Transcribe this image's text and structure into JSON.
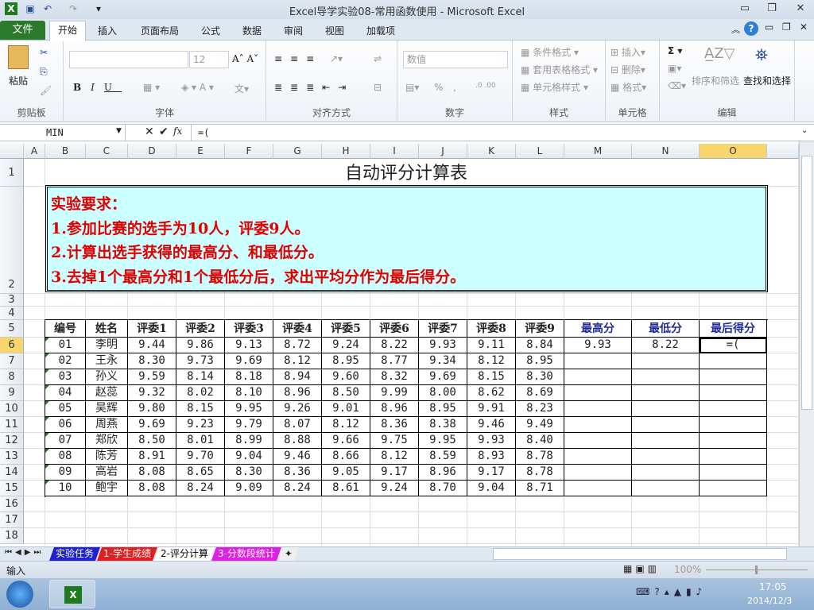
{
  "window": {
    "title": "Excel导学实验08-常用函数使用  -  Microsoft Excel"
  },
  "tabs": [
    "文件",
    "开始",
    "插入",
    "页面布局",
    "公式",
    "数据",
    "审阅",
    "视图",
    "加载项"
  ],
  "ribbon": {
    "clipboard": {
      "paste": "粘贴",
      "label": "剪贴板"
    },
    "font": {
      "name": "",
      "size": "12",
      "label": "字体"
    },
    "alignment": {
      "label": "对齐方式"
    },
    "number": {
      "format": "数值",
      "percent": "%",
      "comma": ",",
      "label": "数字"
    },
    "styles": {
      "conditional": "条件格式",
      "table": "套用表格格式",
      "cell": "单元格样式",
      "label": "样式"
    },
    "cells": {
      "insert": "插入",
      "delete": "删除",
      "format": "格式",
      "label": "单元格"
    },
    "editing": {
      "sort": "排序和筛选",
      "find": "查找和选择",
      "label": "编辑"
    }
  },
  "formula_bar": {
    "name_box": "MIN",
    "formula": "=(",
    "fx": "fx"
  },
  "columns": [
    "A",
    "B",
    "C",
    "D",
    "E",
    "F",
    "G",
    "H",
    "I",
    "J",
    "K",
    "L",
    "M",
    "N",
    "O"
  ],
  "rows": [
    "1",
    "2",
    "3",
    "4",
    "5",
    "6",
    "7",
    "8",
    "9",
    "10",
    "11",
    "12",
    "13",
    "14",
    "15",
    "16",
    "17",
    "18"
  ],
  "sheet": {
    "title": "自动评分计算表",
    "requirements": [
      "实验要求：",
      "1.参加比赛的选手为10人，评委9人。",
      "2.计算出选手获得的最高分、和最低分。",
      "3.去掉1个最高分和1个最低分后，求出平均分作为最后得分。"
    ],
    "headers": [
      "编号",
      "姓名",
      "评委1",
      "评委2",
      "评委3",
      "评委4",
      "评委5",
      "评委6",
      "评委7",
      "评委8",
      "评委9",
      "最高分",
      "最低分",
      "最后得分"
    ],
    "data": [
      [
        "01",
        "李明",
        "9.44",
        "9.86",
        "9.13",
        "8.72",
        "9.24",
        "8.22",
        "9.93",
        "9.11",
        "8.84",
        "9.93",
        "8.22",
        "=("
      ],
      [
        "02",
        "王永",
        "8.30",
        "9.73",
        "9.69",
        "8.12",
        "8.95",
        "8.77",
        "9.34",
        "8.12",
        "8.95",
        "",
        "",
        ""
      ],
      [
        "03",
        "孙义",
        "9.59",
        "8.14",
        "8.18",
        "8.94",
        "9.60",
        "8.32",
        "9.69",
        "8.15",
        "8.30",
        "",
        "",
        ""
      ],
      [
        "04",
        "赵蕊",
        "9.32",
        "8.02",
        "8.10",
        "8.96",
        "8.50",
        "9.99",
        "8.00",
        "8.62",
        "8.69",
        "",
        "",
        ""
      ],
      [
        "05",
        "吴辉",
        "9.80",
        "8.15",
        "9.95",
        "9.26",
        "9.01",
        "8.96",
        "8.95",
        "9.91",
        "8.23",
        "",
        "",
        ""
      ],
      [
        "06",
        "周燕",
        "9.69",
        "9.23",
        "9.79",
        "8.07",
        "8.12",
        "8.36",
        "8.38",
        "9.46",
        "9.49",
        "",
        "",
        ""
      ],
      [
        "07",
        "郑欣",
        "8.50",
        "8.01",
        "8.99",
        "8.88",
        "9.66",
        "9.75",
        "9.95",
        "9.93",
        "8.40",
        "",
        "",
        ""
      ],
      [
        "08",
        "陈芳",
        "8.91",
        "9.70",
        "9.04",
        "9.46",
        "8.66",
        "8.12",
        "8.59",
        "8.93",
        "8.78",
        "",
        "",
        ""
      ],
      [
        "09",
        "高岩",
        "8.08",
        "8.65",
        "8.30",
        "8.36",
        "9.05",
        "9.17",
        "8.96",
        "9.17",
        "8.78",
        "",
        "",
        ""
      ],
      [
        "10",
        "鲍宇",
        "8.08",
        "8.24",
        "9.09",
        "8.24",
        "8.61",
        "9.24",
        "8.70",
        "9.04",
        "8.71",
        "",
        "",
        ""
      ]
    ]
  },
  "sheet_tabs": [
    {
      "name": "实验任务",
      "color": "#2020d0"
    },
    {
      "name": "1-学生成绩",
      "color": "#e02020"
    },
    {
      "name": "2-评分计算",
      "color": "#ffffff"
    },
    {
      "name": "3-分数段统计",
      "color": "#e020e0"
    }
  ],
  "status": {
    "mode": "输入",
    "zoom": "100%"
  },
  "taskbar": {
    "time": "17:05",
    "date": "2014/12/3"
  },
  "colors": {
    "accent_red": "#e00000",
    "header_blue": "#1f2c9a",
    "req_bg": "#ccffff",
    "selected_col": "#f9d56e"
  }
}
